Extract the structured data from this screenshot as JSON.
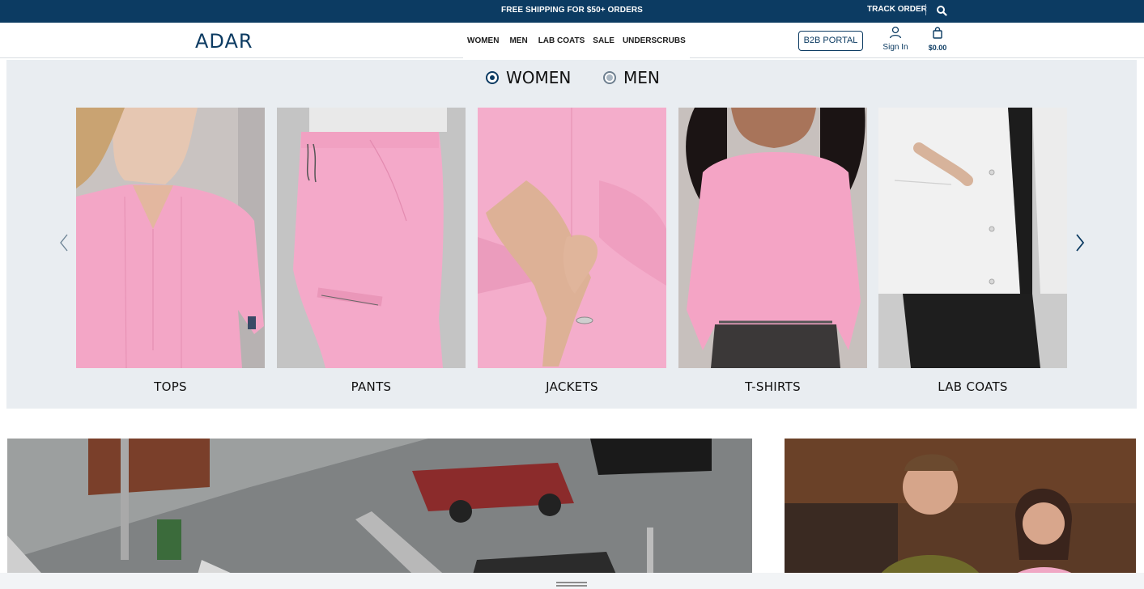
{
  "topbar": {
    "promo": "FREE SHIPPING FOR $50+ ORDERS",
    "track_order": "TRACK ORDER",
    "search_icon": "search-icon",
    "bg_color": "#0c3b62"
  },
  "header": {
    "logo": "ADAR",
    "nav": [
      "WOMEN",
      "MEN",
      "LAB COATS",
      "SALE",
      "UNDERSCRUBS"
    ],
    "b2b_portal": "B2B PORTAL",
    "sign_in": "Sign In",
    "user_icon": "user-icon",
    "cart_icon": "shopping-bag-icon",
    "cart_total": "$0.00",
    "accent_color": "#0c3b62"
  },
  "categories": {
    "gender_options": [
      {
        "label": "WOMEN",
        "selected": true
      },
      {
        "label": "MEN",
        "selected": false
      }
    ],
    "tiles": [
      {
        "label": "TOPS"
      },
      {
        "label": "PANTS"
      },
      {
        "label": "JACKETS"
      },
      {
        "label": "T-SHIRTS"
      },
      {
        "label": "LAB COATS"
      }
    ],
    "prev_icon": "chevron-left-icon",
    "next_icon": "chevron-right-icon"
  }
}
